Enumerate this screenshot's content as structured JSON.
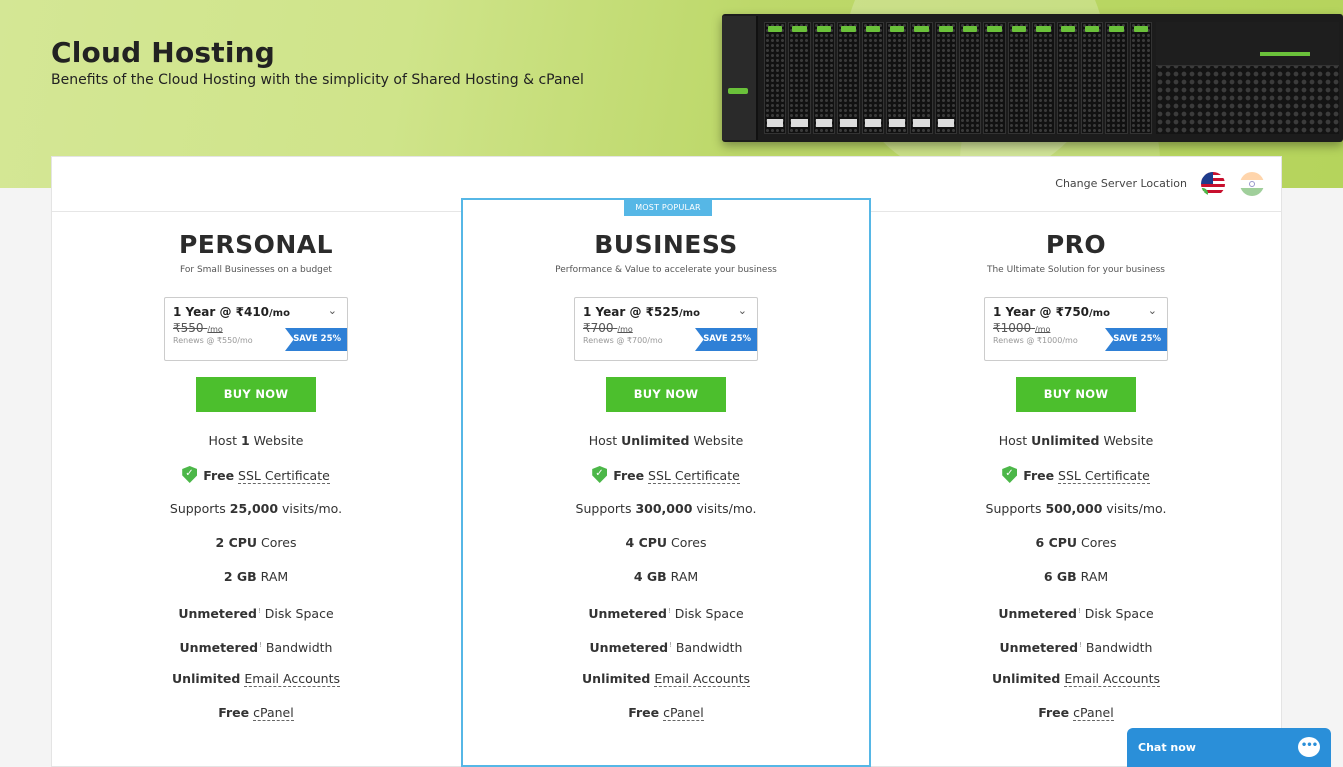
{
  "hero": {
    "title": "Cloud Hosting",
    "subtitle": "Benefits of the Cloud Hosting with the simplicity of Shared Hosting & cPanel"
  },
  "location": {
    "label": "Change Server Location",
    "flags": [
      "us-flag-icon",
      "india-flag-icon"
    ]
  },
  "colors": {
    "accent_green": "#4cbf2d",
    "accent_blue": "#56b7e6",
    "save_blue": "#2f80d6",
    "chat_blue": "#2a8fd9"
  },
  "plans": [
    {
      "name": "PERSONAL",
      "desc": "For Small Businesses on a budget",
      "term": "1 Year @ ₹410",
      "per": "/mo",
      "old_price": "₹550",
      "old_per": "/mo",
      "renews": "Renews @ ₹550/mo",
      "save": "SAVE 25%",
      "buy": "BUY NOW",
      "f_host_pre": "Host ",
      "f_host_val": "1",
      "f_host_post": " Website",
      "f_ssl_free": "Free",
      "f_ssl_label": "SSL Certificate",
      "f_visits_pre": "Supports ",
      "f_visits_val": "25,000",
      "f_visits_post": " visits/mo.",
      "f_cpu_val": "2 CPU",
      "f_cpu_post": " Cores",
      "f_ram_val": "2 GB",
      "f_ram_post": " RAM",
      "f_disk_val": "Unmetered",
      "f_disk_post": " Disk Space",
      "f_bw_val": "Unmetered",
      "f_bw_post": " Bandwidth",
      "f_email_val": "Unlimited",
      "f_email_label": "Email Accounts",
      "f_cpanel_free": "Free",
      "f_cpanel_label": "cPanel"
    },
    {
      "badge": "MOST POPULAR",
      "name": "BUSINESS",
      "desc": "Performance & Value to accelerate your business",
      "term": "1 Year @ ₹525",
      "per": "/mo",
      "old_price": "₹700",
      "old_per": "/mo",
      "renews": "Renews @ ₹700/mo",
      "save": "SAVE 25%",
      "buy": "BUY NOW",
      "f_host_pre": "Host ",
      "f_host_val": "Unlimited",
      "f_host_post": " Website",
      "f_ssl_free": "Free",
      "f_ssl_label": "SSL Certificate",
      "f_visits_pre": "Supports ",
      "f_visits_val": "300,000",
      "f_visits_post": " visits/mo.",
      "f_cpu_val": "4 CPU",
      "f_cpu_post": " Cores",
      "f_ram_val": "4 GB",
      "f_ram_post": " RAM",
      "f_disk_val": "Unmetered",
      "f_disk_post": " Disk Space",
      "f_bw_val": "Unmetered",
      "f_bw_post": " Bandwidth",
      "f_email_val": "Unlimited",
      "f_email_label": "Email Accounts",
      "f_cpanel_free": "Free",
      "f_cpanel_label": "cPanel"
    },
    {
      "name": "PRO",
      "desc": "The Ultimate Solution for your business",
      "term": "1 Year @ ₹750",
      "per": "/mo",
      "old_price": "₹1000",
      "old_per": "/mo",
      "renews": "Renews @ ₹1000/mo",
      "save": "SAVE 25%",
      "buy": "BUY NOW",
      "f_host_pre": "Host ",
      "f_host_val": "Unlimited",
      "f_host_post": " Website",
      "f_ssl_free": "Free",
      "f_ssl_label": "SSL Certificate",
      "f_visits_pre": "Supports ",
      "f_visits_val": "500,000",
      "f_visits_post": " visits/mo.",
      "f_cpu_val": "6 CPU",
      "f_cpu_post": " Cores",
      "f_ram_val": "6 GB",
      "f_ram_post": " RAM",
      "f_disk_val": "Unmetered",
      "f_disk_post": " Disk Space",
      "f_bw_val": "Unmetered",
      "f_bw_post": " Bandwidth",
      "f_email_val": "Unlimited",
      "f_email_label": "Email Accounts",
      "f_cpanel_free": "Free",
      "f_cpanel_label": "cPanel"
    }
  ],
  "chat": {
    "label": "Chat now",
    "icon": "chat-bubble-icon"
  }
}
